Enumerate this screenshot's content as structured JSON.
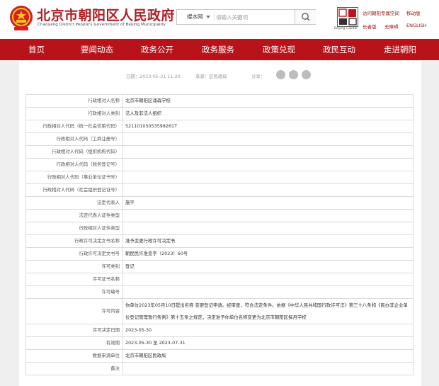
{
  "header": {
    "site_title": "北京市朝阳区人民政府",
    "site_subtitle": "Chaoyang District People's Government of Beijing Municipality",
    "search": {
      "scope": "搜本网",
      "placeholder": "请输入关键词"
    },
    "capital_caption": "Beijing Capital",
    "links": {
      "elder_mode": "访问朝阳专属空间",
      "mobile": "移动版",
      "elderly": "长者版",
      "accessible": "无障碍",
      "english": "ENGLISH"
    }
  },
  "nav": [
    "首页",
    "要闻动态",
    "政务公开",
    "政务服务",
    "政策兑现",
    "政民互动",
    "走进朝阳"
  ],
  "meta": {
    "date": "日期：2023-05-31 11:20",
    "source": "来源：区民政局",
    "share_label": "分享："
  },
  "share_icons": [
    "wechat-icon",
    "weibo-icon",
    "qzone-icon"
  ],
  "record": [
    {
      "label": "行政相对人名称",
      "value": "北京市朝阳区涌森学校"
    },
    {
      "label": "行政相对人类别",
      "value": "法人及非法人组织"
    },
    {
      "label": "行政相对人代码（统一社会信用代码）",
      "value": "52110105053598261T"
    },
    {
      "label": "行政相对人代码（工商注册号）",
      "value": ""
    },
    {
      "label": "行政相对人代码（组织机构代码）",
      "value": ""
    },
    {
      "label": "行政相对人代码（税务登记号）",
      "value": ""
    },
    {
      "label": "行政相对人代码（事业单位证书号）",
      "value": ""
    },
    {
      "label": "行政相对人代码（社会组织登记证号）",
      "value": ""
    },
    {
      "label": "法定代表人",
      "value": "施平"
    },
    {
      "label": "法定代表人证件类型",
      "value": ""
    },
    {
      "label": "行政相对人证件类型",
      "value": ""
    },
    {
      "label": "行政许可决定文书名称",
      "value": "准予变更行政许可决定书"
    },
    {
      "label": "行政许可决定文书号",
      "value": "朝民民许准变字（2023）60号"
    },
    {
      "label": "许可类别",
      "value": "登记"
    },
    {
      "label": "许可证书名称",
      "value": ""
    },
    {
      "label": "许可编号",
      "value": ""
    },
    {
      "label": "许可内容",
      "value": "你单位2023年05月10日提出名称 变更登记申请。经审查，符合法定条件。依据《中华人民共和国行政许可法》第三十八条和《民办非企业单位登记管理暂行条例》第十五条之规定，决定准予你单位名称变更为北京市朝阳区探月学校",
      "tall": true
    },
    {
      "label": "许可决定日期",
      "value": "2023-05-30"
    },
    {
      "label": "有效期",
      "value": "2023-05-30 至 2023-07-31"
    },
    {
      "label": "数据来源单位",
      "value": "北京市朝阳区民政局"
    },
    {
      "label": "备注",
      "value": ""
    }
  ],
  "colors": {
    "brand_red": "#b8131b",
    "title_red": "#b01d22",
    "page_bg": "#efefef"
  }
}
